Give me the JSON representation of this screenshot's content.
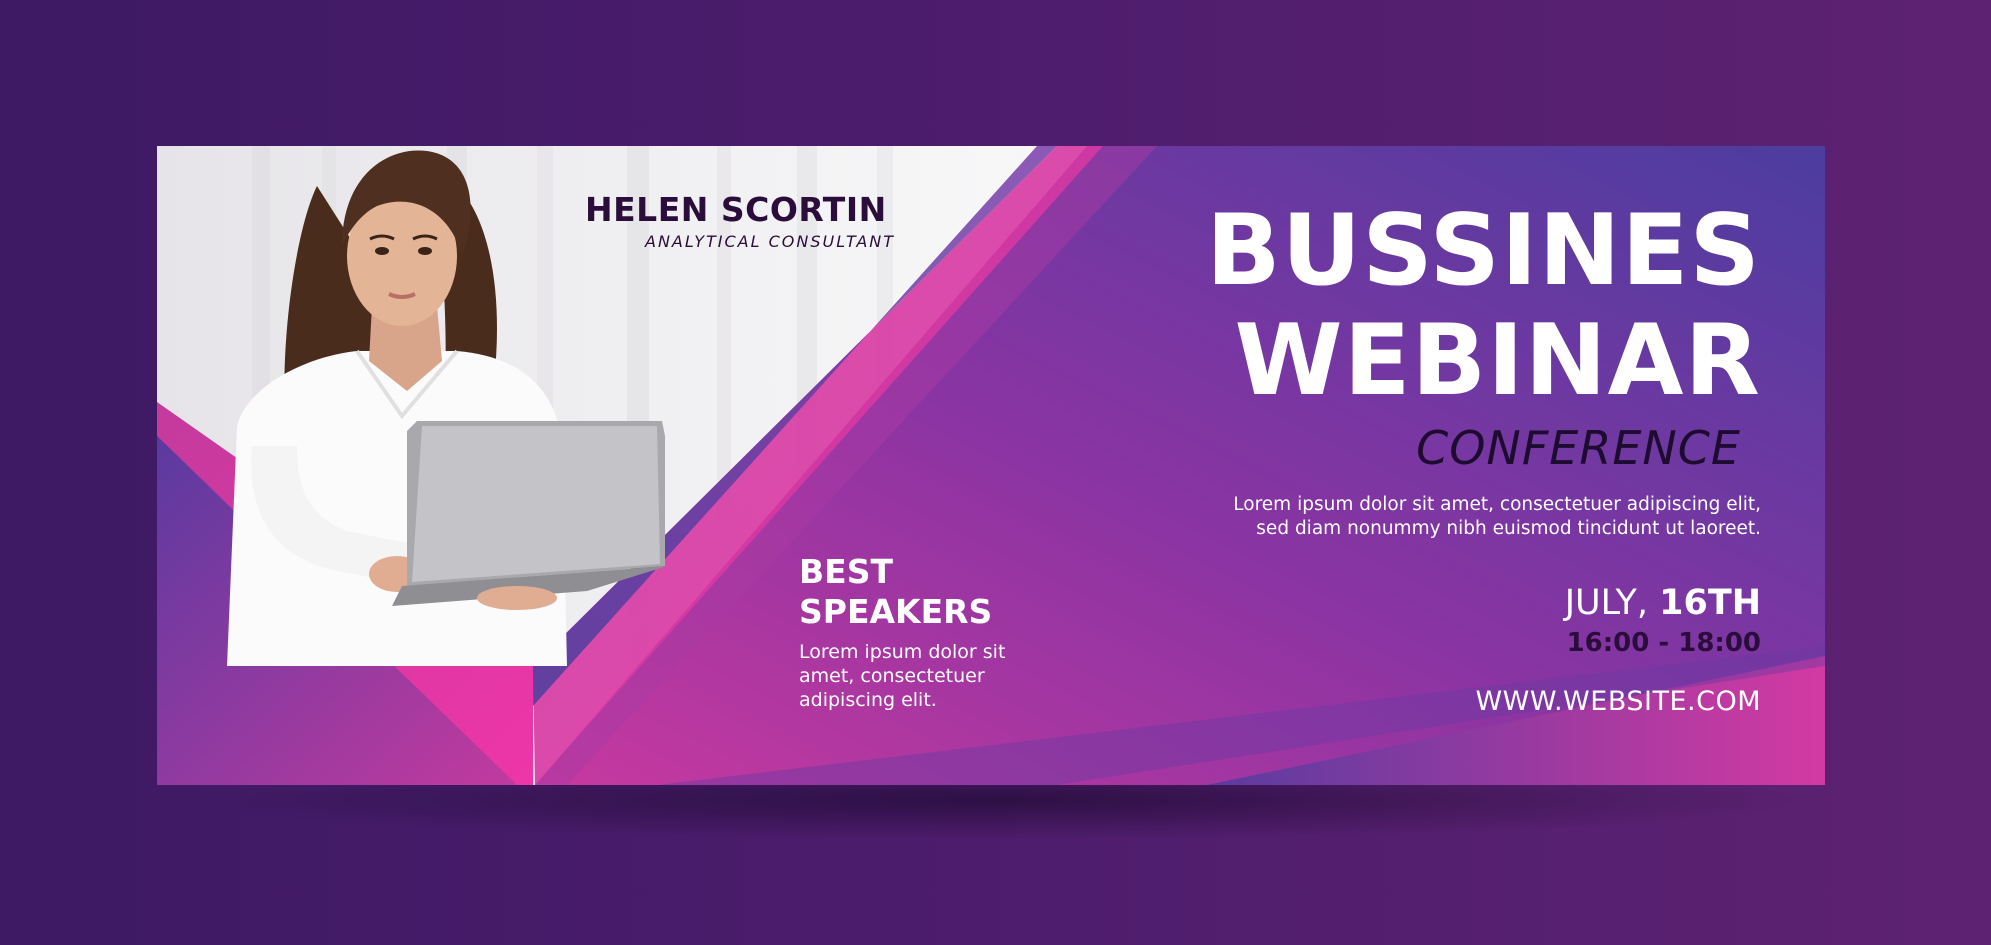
{
  "speaker": {
    "name": "HELEN SCORTIN",
    "role": "ANALYTICAL CONSULTANT"
  },
  "event": {
    "title_line1": "BUSSINES",
    "title_line2": "WEBINAR",
    "subtitle": "CONFERENCE",
    "description": "Lorem ipsum dolor sit amet, consectetuer adipiscing elit, sed diam nonummy nibh euismod tincidunt ut laoreet.",
    "date_month": "JULY,",
    "date_day": "16TH",
    "time": "16:00 - 18:00",
    "website": "WWW.WEBSITE.COM"
  },
  "speakers_section": {
    "line1": "BEST",
    "line2": "SPEAKERS",
    "description": "Lorem ipsum dolor sit amet, consectetuer adipiscing elit."
  },
  "colors": {
    "page_background": "#4c1c6c",
    "purple": "#7a37a3",
    "magenta": "#e0389e",
    "deep_blue": "#4a3a9a",
    "dark_text": "#2a0d3a",
    "white_text": "#ffffff"
  },
  "icons": [
    "woman-with-laptop-photo"
  ]
}
